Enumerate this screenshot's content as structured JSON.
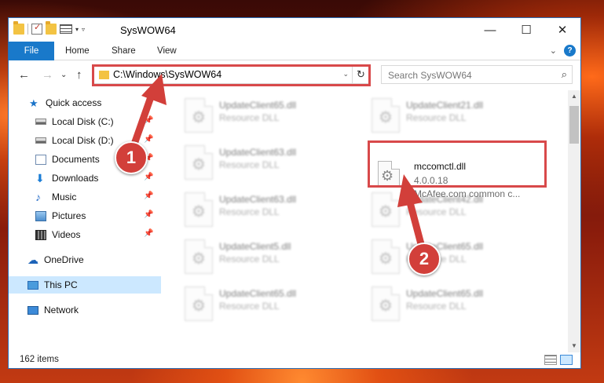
{
  "window": {
    "title": "SysWOW64",
    "controls": {
      "minimize": "—",
      "maximize": "☐",
      "close": "✕"
    }
  },
  "ribbon": {
    "tabs": [
      {
        "label": "File"
      },
      {
        "label": "Home"
      },
      {
        "label": "Share"
      },
      {
        "label": "View"
      }
    ],
    "help": "?"
  },
  "address": {
    "path": "C:\\Windows\\SysWOW64",
    "search_placeholder": "Search SysWOW64"
  },
  "navigation": {
    "quick_access": "Quick access",
    "pinned": [
      {
        "label": "Local Disk (C:)",
        "icon": "disk-icon"
      },
      {
        "label": "Local Disk (D:)",
        "icon": "disk-icon"
      },
      {
        "label": "Documents",
        "icon": "documents-icon"
      },
      {
        "label": "Downloads",
        "icon": "downloads-icon"
      },
      {
        "label": "Music",
        "icon": "music-icon"
      },
      {
        "label": "Pictures",
        "icon": "pictures-icon"
      },
      {
        "label": "Videos",
        "icon": "videos-icon"
      }
    ],
    "onedrive": "OneDrive",
    "this_pc": "This PC",
    "network": "Network"
  },
  "files": [
    {
      "name": "UpdateClient65.dll",
      "type": "Resource DLL"
    },
    {
      "name": "UpdateClient21.dll",
      "type": "Resource DLL"
    },
    {
      "name": "UpdateClient63.dll",
      "type": "Resource DLL"
    },
    {
      "name": "mccomctl.dll",
      "version": "4.0.0.18",
      "description": "McAfee.com common c..."
    },
    {
      "name": "UpdateClient63.dll",
      "type": "Resource DLL"
    },
    {
      "name": "UpdateClient42.dll",
      "type": "Resource DLL"
    },
    {
      "name": "UpdateClient5.dll",
      "type": "Resource DLL"
    },
    {
      "name": "UpdateClient65.dll",
      "type": "Resource DLL"
    },
    {
      "name": "UpdateClient65.dll",
      "type": "Resource DLL"
    },
    {
      "name": "UpdateClient65.dll",
      "type": "Resource DLL"
    }
  ],
  "status": {
    "item_count": "162 items"
  },
  "annotations": {
    "step1": "1",
    "step2": "2",
    "highlight_color": "#d8494a"
  }
}
